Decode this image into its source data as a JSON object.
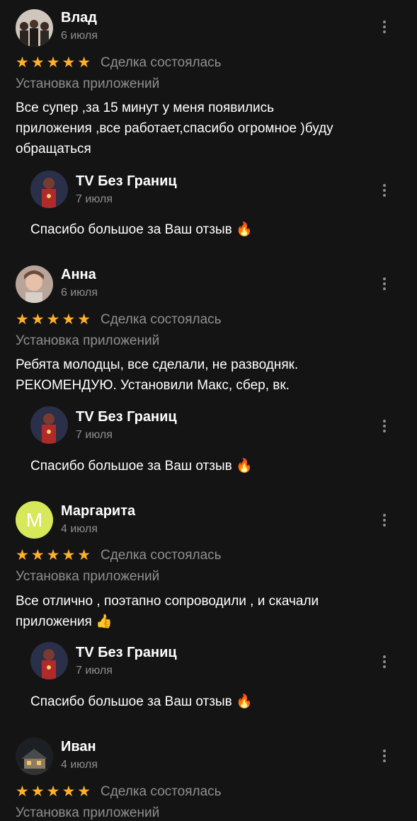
{
  "reviews": [
    {
      "name": "Влад",
      "date": "6 июля",
      "stars": "★★★★★",
      "status": "Сделка состоялась",
      "service": "Установка приложений",
      "text_lines": [
        "Все супер ,за 15 минут у меня появились",
        "приложения ,все работает,спасибо огромное )буду",
        "обращаться"
      ],
      "reply": {
        "name": "TV Без Границ",
        "date": "7 июля",
        "text": "Спасибо большое за Ваш отзыв",
        "emoji": "🔥"
      }
    },
    {
      "name": "Анна",
      "date": "6 июля",
      "stars": "★★★★★",
      "status": "Сделка состоялась",
      "service": "Установка приложений",
      "text_lines": [
        "Ребята молодцы, все сделали, не разводняк.",
        "РЕКОМЕНДУЮ. Установили Макс, сбер, вк."
      ],
      "reply": {
        "name": "TV Без Границ",
        "date": "7 июля",
        "text": "Спасибо большое за Ваш отзыв",
        "emoji": "🔥"
      }
    },
    {
      "name": "Маргарита",
      "avatar_letter": "М",
      "date": "4 июля",
      "stars": "★★★★★",
      "status": "Сделка состоялась",
      "service": "Установка приложений",
      "text_lines": [
        "Все отлично , поэтапно сопроводили , и скачали",
        "приложения"
      ],
      "text_emoji": "👍",
      "reply": {
        "name": "TV Без Границ",
        "date": "7 июля",
        "text": "Спасибо большое за Ваш отзыв",
        "emoji": "🔥"
      }
    },
    {
      "name": "Иван",
      "date": "4 июля",
      "stars": "★★★★★",
      "status": "Сделка состоялась",
      "service": "Установка приложений"
    }
  ],
  "colors": {
    "background": "#141414",
    "star": "#ffb12b",
    "muted": "#8f8f8f",
    "avatar_m": "#d7e85a"
  }
}
